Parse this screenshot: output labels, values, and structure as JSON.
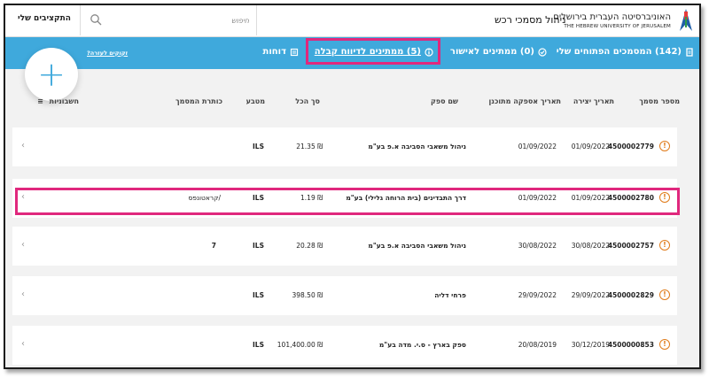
{
  "header": {
    "university_he": "האוניברסיטה העברית בירושלים",
    "university_en": "THE HEBREW UNIVERSITY OF JERUSALEM",
    "app_title": "ניהול מסמכי רכש",
    "search_placeholder": "חיפוש",
    "my_budgets": "התקציבים שלי"
  },
  "nav": {
    "open_docs": "(142) המסמכים הפתוחים שלי",
    "pending_approval": "(0) ממתינים לאישור",
    "pending_receipt": "(5) ממתינים לדיווח קבלה",
    "reports": "דוחות",
    "help": "זקוקים לעזרה?",
    "active_tab": "pending_receipt",
    "accent_color": "#3fa9dc",
    "highlight_color": "#e0287d"
  },
  "table": {
    "columns": [
      "מספר מסמך",
      "תאריך יצירה",
      "תאריך אספקה מתוכנן",
      "שם ספק",
      "סך הכל",
      "מטבע",
      "כותרת המסמך",
      "חשבוניות"
    ],
    "rows": [
      {
        "doc": "4500002779",
        "created": "01/09/2022",
        "delivery": "01/09/2022",
        "vendor": "ניהול משאבי הסביבה א.פ בע\"מ",
        "total": "₪ 21.35",
        "currency": "ILS",
        "title": "",
        "invoices": ""
      },
      {
        "doc": "4500002780",
        "created": "01/09/2022",
        "delivery": "01/09/2022",
        "vendor": "דרך התבדינים (בית הרוחה גלילי) בע\"מ",
        "total": "₪ 1.19",
        "currency": "ILS",
        "title": "/קראטונפס",
        "invoices": ""
      },
      {
        "doc": "4500002757",
        "created": "30/08/2022",
        "delivery": "30/08/2022",
        "vendor": "ניהול משאבי הסביבה א.פ בע\"מ",
        "total": "₪ 20.28",
        "currency": "ILS",
        "title": "7",
        "invoices": ""
      },
      {
        "doc": "4500002829",
        "created": "29/09/2022",
        "delivery": "29/09/2022",
        "vendor": "פרחי דליה",
        "total": "₪ 398.50",
        "currency": "ILS",
        "title": "",
        "invoices": ""
      },
      {
        "doc": "4500000853",
        "created": "30/12/2019",
        "delivery": "20/08/2019",
        "vendor": "ספק בארץ - ס.י. מדה בע\"מ",
        "total": "₪ 101,400.00",
        "currency": "ILS",
        "title": "",
        "invoices": ""
      }
    ]
  },
  "fab_label": "+",
  "alert_glyph": "!",
  "chevron_glyph": "‹",
  "menu_glyph": "≡"
}
